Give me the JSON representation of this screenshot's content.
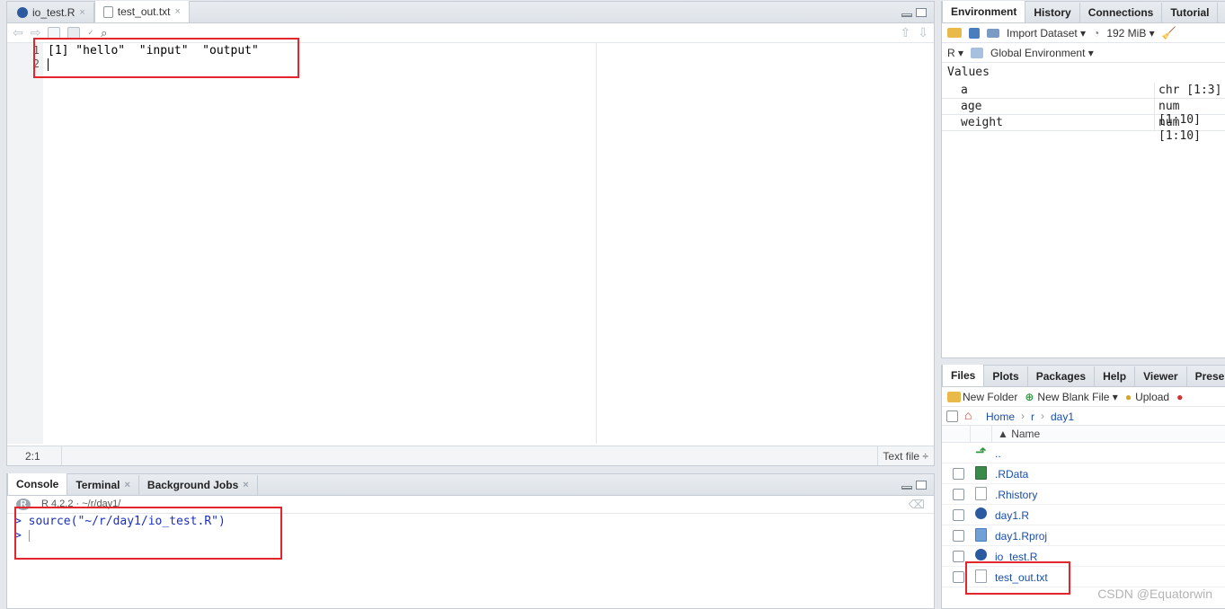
{
  "source_pane": {
    "tabs": [
      {
        "label": "io_test.R",
        "close": "×"
      },
      {
        "label": "test_out.txt",
        "close": "×"
      }
    ],
    "line_numbers": [
      "1",
      "2"
    ],
    "lines": [
      "[1] \"hello\"  \"input\"  \"output\"",
      ""
    ],
    "cursor_pos": "2:1",
    "file_type": "Text file ÷"
  },
  "console_pane": {
    "tabs": [
      {
        "label": "Console"
      },
      {
        "label": "Terminal",
        "close": "×"
      },
      {
        "label": "Background Jobs",
        "close": "×"
      }
    ],
    "r_version": "R 4.2.2 · ~/r/day1/",
    "command": "source(\"~/r/day1/io_test.R\")",
    "prompt": ">"
  },
  "env_pane": {
    "tabs": [
      {
        "label": "Environment"
      },
      {
        "label": "History"
      },
      {
        "label": "Connections"
      },
      {
        "label": "Tutorial"
      }
    ],
    "import_dataset": "Import Dataset ▾",
    "memory": "192 MiB ▾",
    "language": "R ▾",
    "scope": "Global Environment ▾",
    "section": "Values",
    "variables": [
      {
        "name": "a",
        "value": "chr [1:3]"
      },
      {
        "name": "age",
        "value": "num [1:10]"
      },
      {
        "name": "weight",
        "value": "num [1:10]"
      }
    ]
  },
  "files_pane": {
    "tabs": [
      {
        "label": "Files"
      },
      {
        "label": "Plots"
      },
      {
        "label": "Packages"
      },
      {
        "label": "Help"
      },
      {
        "label": "Viewer"
      },
      {
        "label": "Present"
      }
    ],
    "new_folder": "New Folder",
    "new_blank_file": "New Blank File ▾",
    "upload": "Upload",
    "breadcrumb": {
      "home": "Home",
      "sep1": "›",
      "r": "r",
      "sep2": "›",
      "day1": "day1"
    },
    "column_name": "▲ Name",
    "files": [
      {
        "name": "..",
        "icon": "up-arrow-icon"
      },
      {
        "name": ".RData",
        "icon": "rdata-icon"
      },
      {
        "name": ".Rhistory",
        "icon": "rhistory-icon"
      },
      {
        "name": "day1.R",
        "icon": "r-file-icon"
      },
      {
        "name": "day1.Rproj",
        "icon": "rproj-icon"
      },
      {
        "name": "io_test.R",
        "icon": "r-file-icon"
      },
      {
        "name": "test_out.txt",
        "icon": "text-file-icon"
      }
    ]
  },
  "watermark": "CSDN @Equatorwin"
}
